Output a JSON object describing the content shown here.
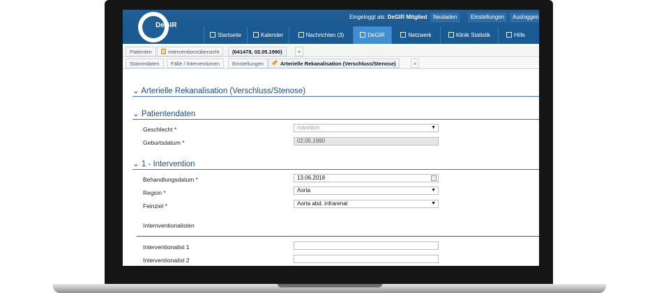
{
  "app": {
    "logo": "DeGIR",
    "logged_in_label": "Eingeloggt als:",
    "logged_in_user": "DeGIR Mitglied",
    "top_actions": [
      "Neuladen",
      "Einstellungen",
      "Ausloggen"
    ]
  },
  "nav": {
    "items": [
      {
        "label": "Startseite",
        "icon": "home-icon"
      },
      {
        "label": "Kalender",
        "icon": "calendar-icon"
      },
      {
        "label": "Nachrichten (3)",
        "icon": "mail-icon"
      },
      {
        "label": "DeGIR",
        "icon": "id-card-icon",
        "active": true
      },
      {
        "label": "Netzwerk",
        "icon": "network-icon"
      },
      {
        "label": "Klinik Statistik",
        "icon": "chart-icon"
      },
      {
        "label": "Hilfe",
        "icon": "help-icon"
      }
    ]
  },
  "breadcrumb_tabs": [
    "Patienten",
    "Interventionsübersicht",
    "(641478, 02.05.1990)",
    "×"
  ],
  "subtabs": [
    "Stammdaten",
    "Fälle / Interventionen",
    "Einstellungen",
    "Arterielle Rekanalisation (Verschluss/Stenose)",
    "×"
  ],
  "form": {
    "title": "Arterielle Rekanalisation (Verschluss/Stenose)",
    "patient_section": "Patientendaten",
    "sex_label": "Geschlecht *",
    "sex_value": "männlich",
    "birth_label": "Geburtsdatum *",
    "birth_value": "02.05.1990",
    "intervention_section": "1 - Intervention",
    "treatment_date_label": "Behandlungsdatum *",
    "treatment_date_value": "13.06.2018",
    "region_label": "Region *",
    "region_value": "Aorta",
    "target_label": "Feinziel *",
    "target_value": "Aorta abd. infrarenal",
    "interventionalists_label": "Internventionalisten",
    "interventionalist1_label": "Interventionalist 1",
    "interventionalist1_value": "",
    "interventionalist2_label": "Interventionalist 2",
    "interventionalist2_value": ""
  }
}
